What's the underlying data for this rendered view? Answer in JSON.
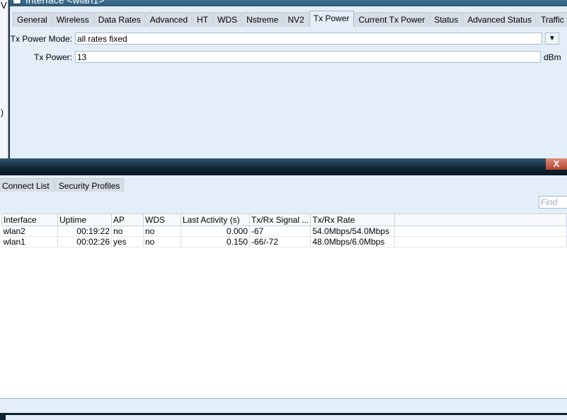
{
  "background_window": {
    "partial_text_1": "V",
    "partial_text_2": ")"
  },
  "interface_window": {
    "title": "Interface <wlan1>",
    "tabs": [
      "General",
      "Wireless",
      "Data Rates",
      "Advanced",
      "HT",
      "WDS",
      "Nstreme",
      "NV2",
      "Tx Power",
      "Current Tx Power",
      "Status",
      "Advanced Status",
      "Traffic"
    ],
    "active_tab": "Tx Power",
    "tx_power_mode": {
      "label": "Tx Power Mode:",
      "value": "all rates fixed"
    },
    "tx_power": {
      "label": "Tx Power:",
      "value": "13",
      "unit": "dBm"
    }
  },
  "wireless_window": {
    "close_label": "X",
    "tabs": [
      "Connect List",
      "Security Profiles"
    ],
    "find_placeholder": "Find",
    "table": {
      "columns": [
        "Interface",
        "Uptime",
        "AP",
        "WDS",
        "Last Activity (s)",
        "Tx/Rx Signal ...",
        "Tx/Rx Rate"
      ],
      "rows": [
        [
          "wlan2",
          "00:19:22",
          "no",
          "no",
          "0.000",
          "-67",
          "54.0Mbps/54.0Mbps"
        ],
        [
          "wlan1",
          "00:02:26",
          "yes",
          "no",
          "0.150",
          "-66/-72",
          "48.0Mbps/6.0Mbps"
        ]
      ]
    }
  }
}
